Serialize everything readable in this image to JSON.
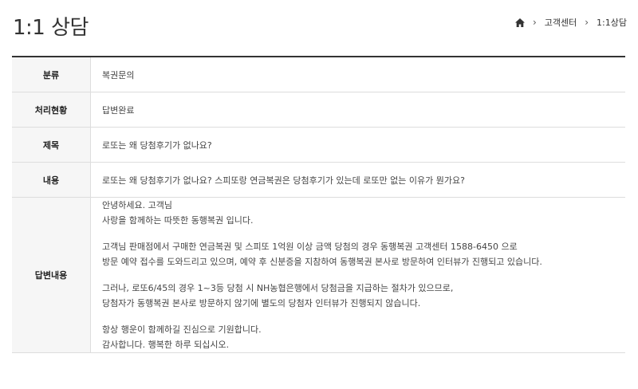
{
  "page": {
    "title": "1:1 상담"
  },
  "breadcrumb": {
    "items": [
      "고객센터",
      "1:1상담"
    ]
  },
  "inquiry": {
    "category_label": "분류",
    "category_value": "복권문의",
    "status_label": "처리현황",
    "status_value": "답변완료",
    "subject_label": "제목",
    "subject_value": "로또는 왜 당첨후기가 없나요?",
    "content_label": "내용",
    "content_value": "로또는 왜 당첨후기가 없나요? 스피또랑 연금복권은 당첨후기가 있는데 로또만 없는 이유가 뭔가요?",
    "answer_label": "답변내용",
    "answer_paragraphs": [
      [
        "안녕하세요. 고객님",
        "사랑을 함께하는 따뜻한 동행복권 입니다."
      ],
      [
        "고객님 판매점에서 구매한 연금복권 및 스피또 1억원 이상 금액 당첨의 경우 동행복권 고객센터 1588-6450 으로",
        "방문 예약 접수를 도와드리고 있으며, 예약 후 신분증을 지참하여 동행복권 본사로 방문하여 인터뷰가 진행되고 있습니다."
      ],
      [
        "그러나, 로또6/45의 경우 1~3등 당첨 시 NH농협은행에서 당첨금을 지급하는 절차가 있으므로,",
        "당첨자가 동행복권 본사로 방문하지 않기에 별도의 당첨자 인터뷰가 진행되지 않습니다."
      ],
      [
        "항상 행운이 함께하길 진심으로 기원합니다.",
        "감사합니다. 행복한 하루 되십시오."
      ]
    ]
  },
  "icons": {
    "home": "home-icon",
    "separator": "chevron-right-icon"
  }
}
